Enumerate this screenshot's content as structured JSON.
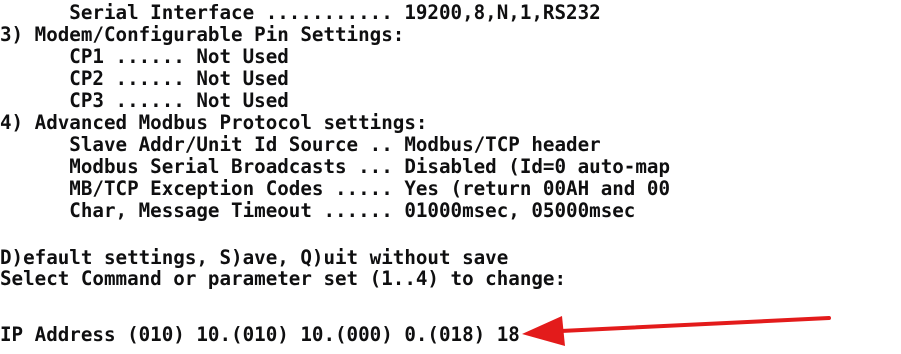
{
  "terminal": {
    "lines": [
      "      Serial Interface ........... 19200,8,N,1,RS232",
      "3) Modem/Configurable Pin Settings:",
      "      CP1 ...... Not Used",
      "      CP2 ...... Not Used",
      "      CP3 ...... Not Used",
      "4) Advanced Modbus Protocol settings:",
      "      Slave Addr/Unit Id Source .. Modbus/TCP header",
      "      Modbus Serial Broadcasts ... Disabled (Id=0 auto-map",
      "      MB/TCP Exception Codes ..... Yes (return 00AH and 00",
      "      Char, Message Timeout ...... 01000msec, 05000msec",
      "",
      "D)efault settings, S)ave, Q)uit without save",
      "Select Command or parameter set (1..4) to change:",
      "",
      "IP Address (010) 10.(010) 10.(000) 0.(018) 18"
    ]
  },
  "colors": {
    "text": "#0f0f10",
    "background": "#ffffff",
    "annotation_arrow": "#e31b1b"
  },
  "icons": {
    "annotation": "red-arrow-icon"
  }
}
